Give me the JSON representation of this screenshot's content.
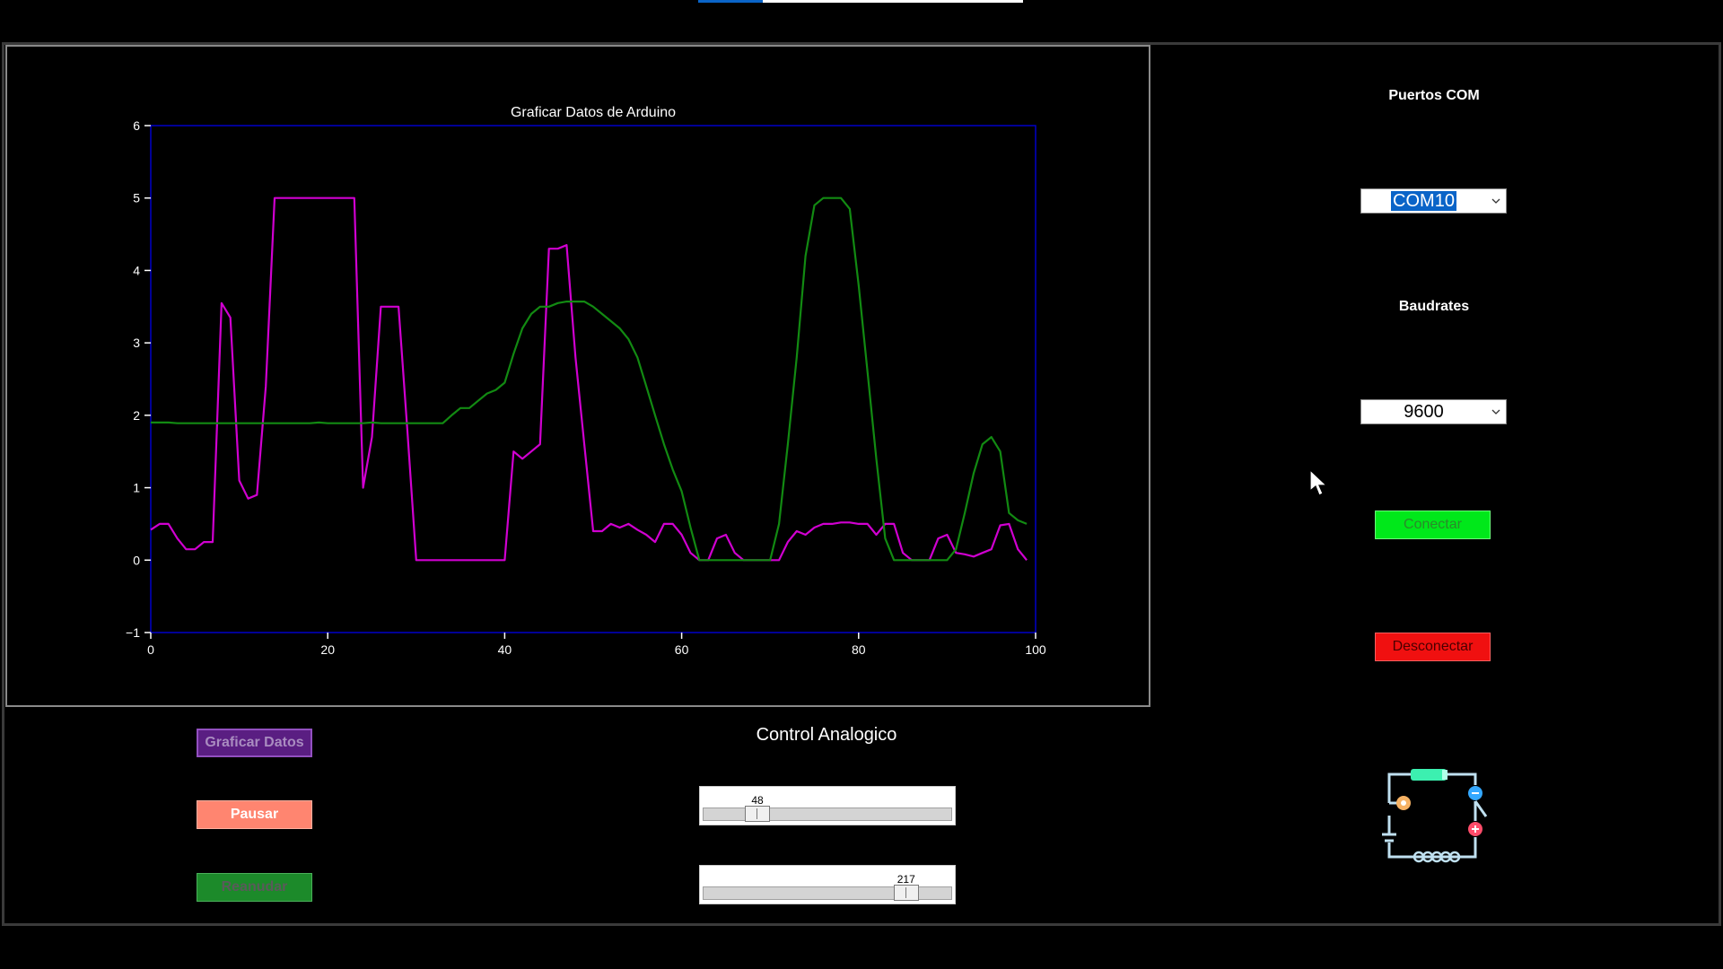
{
  "top_progress": {
    "fraction": 0.2
  },
  "plot": {
    "chart_data": {
      "type": "line",
      "title": "Graficar Datos de Arduino",
      "xlabel": "",
      "ylabel": "",
      "xlim": [
        0,
        100
      ],
      "ylim": [
        -1,
        6
      ],
      "xticks": [
        0,
        20,
        40,
        60,
        80,
        100
      ],
      "yticks": [
        -1,
        0,
        1,
        2,
        3,
        4,
        5,
        6
      ],
      "ytick_labels": [
        "−1",
        "0",
        "1",
        "2",
        "3",
        "4",
        "5",
        "6"
      ],
      "axes_color": "#0000c8",
      "series": [
        {
          "color": "#d000d0",
          "x": [
            0,
            1,
            2,
            3,
            4,
            5,
            6,
            7,
            8,
            9,
            10,
            11,
            12,
            13,
            14,
            15,
            16,
            17,
            18,
            19,
            20,
            21,
            22,
            23,
            24,
            25,
            26,
            27,
            28,
            29,
            30,
            31,
            32,
            33,
            34,
            35,
            36,
            37,
            38,
            39,
            40,
            41,
            42,
            43,
            44,
            45,
            46,
            47,
            48,
            49,
            50,
            51,
            52,
            53,
            54,
            55,
            56,
            57,
            58,
            59,
            60,
            61,
            62,
            63,
            64,
            65,
            66,
            67,
            68,
            69,
            70,
            71,
            72,
            73,
            74,
            75,
            76,
            77,
            78,
            79,
            80,
            81,
            82,
            83,
            84,
            85,
            86,
            87,
            88,
            89,
            90,
            91,
            92,
            93,
            94,
            95,
            96,
            97,
            98,
            99
          ],
          "y": [
            0.42,
            0.5,
            0.5,
            0.3,
            0.15,
            0.15,
            0.25,
            0.25,
            3.55,
            3.35,
            1.1,
            0.85,
            0.9,
            2.4,
            5.0,
            5.0,
            5.0,
            5.0,
            5.0,
            5.0,
            5.0,
            5.0,
            5.0,
            5.0,
            1.0,
            1.7,
            3.5,
            3.5,
            3.5,
            1.8,
            0.0,
            0.0,
            0.0,
            0.0,
            0.0,
            0.0,
            0.0,
            0.0,
            0.0,
            0.0,
            0.0,
            1.5,
            1.4,
            1.5,
            1.6,
            4.3,
            4.3,
            4.35,
            2.8,
            1.6,
            0.4,
            0.4,
            0.5,
            0.45,
            0.5,
            0.42,
            0.35,
            0.25,
            0.5,
            0.5,
            0.35,
            0.1,
            0.0,
            0.0,
            0.3,
            0.35,
            0.1,
            0.0,
            0.0,
            0.0,
            0.0,
            0.0,
            0.25,
            0.4,
            0.35,
            0.45,
            0.5,
            0.5,
            0.52,
            0.52,
            0.5,
            0.5,
            0.35,
            0.5,
            0.5,
            0.1,
            0.0,
            0.0,
            0.0,
            0.3,
            0.35,
            0.1,
            0.08,
            0.05,
            0.1,
            0.15,
            0.48,
            0.5,
            0.15,
            0.0
          ]
        },
        {
          "color": "#128a12",
          "x": [
            0,
            1,
            2,
            3,
            4,
            5,
            6,
            7,
            8,
            9,
            10,
            11,
            12,
            13,
            14,
            15,
            16,
            17,
            18,
            19,
            20,
            21,
            22,
            23,
            24,
            25,
            26,
            27,
            28,
            29,
            30,
            31,
            32,
            33,
            34,
            35,
            36,
            37,
            38,
            39,
            40,
            41,
            42,
            43,
            44,
            45,
            46,
            47,
            48,
            49,
            50,
            51,
            52,
            53,
            54,
            55,
            56,
            57,
            58,
            59,
            60,
            61,
            62,
            63,
            64,
            65,
            66,
            67,
            68,
            69,
            70,
            71,
            72,
            73,
            74,
            75,
            76,
            77,
            78,
            79,
            80,
            81,
            82,
            83,
            84,
            85,
            86,
            87,
            88,
            89,
            90,
            91,
            92,
            93,
            94,
            95,
            96,
            97,
            98,
            99
          ],
          "y": [
            1.9,
            1.9,
            1.9,
            1.89,
            1.89,
            1.89,
            1.89,
            1.89,
            1.89,
            1.89,
            1.89,
            1.89,
            1.89,
            1.89,
            1.89,
            1.89,
            1.89,
            1.89,
            1.89,
            1.9,
            1.89,
            1.89,
            1.89,
            1.89,
            1.89,
            1.9,
            1.89,
            1.89,
            1.89,
            1.89,
            1.89,
            1.89,
            1.89,
            1.89,
            2.0,
            2.1,
            2.1,
            2.2,
            2.3,
            2.35,
            2.45,
            2.85,
            3.2,
            3.4,
            3.5,
            3.5,
            3.55,
            3.57,
            3.57,
            3.57,
            3.5,
            3.4,
            3.3,
            3.2,
            3.05,
            2.8,
            2.4,
            2.0,
            1.6,
            1.25,
            0.95,
            0.45,
            0.0,
            0.0,
            0.0,
            0.0,
            0.0,
            0.0,
            0.0,
            0.0,
            0.0,
            0.5,
            1.6,
            2.8,
            4.2,
            4.9,
            5.0,
            5.0,
            5.0,
            4.85,
            3.8,
            2.6,
            1.4,
            0.3,
            0.0,
            0.0,
            0.0,
            0.0,
            0.0,
            0.0,
            0.0,
            0.15,
            0.65,
            1.2,
            1.6,
            1.7,
            1.5,
            0.65,
            0.55,
            0.5
          ]
        }
      ]
    }
  },
  "buttons": {
    "graficar": "Graficar Datos",
    "pausar": "Pausar",
    "reanudar": "Reanudar",
    "conectar": "Conectar",
    "desconectar": "Desconectar"
  },
  "control": {
    "title": "Control Analogico",
    "slider1": {
      "value": 48,
      "min": 0,
      "max": 255
    },
    "slider2": {
      "value": 217,
      "min": 0,
      "max": 255
    }
  },
  "sidebar": {
    "com_label": "Puertos COM",
    "com_value": "COM10",
    "baud_label": "Baudrates",
    "baud_value": "9600"
  }
}
